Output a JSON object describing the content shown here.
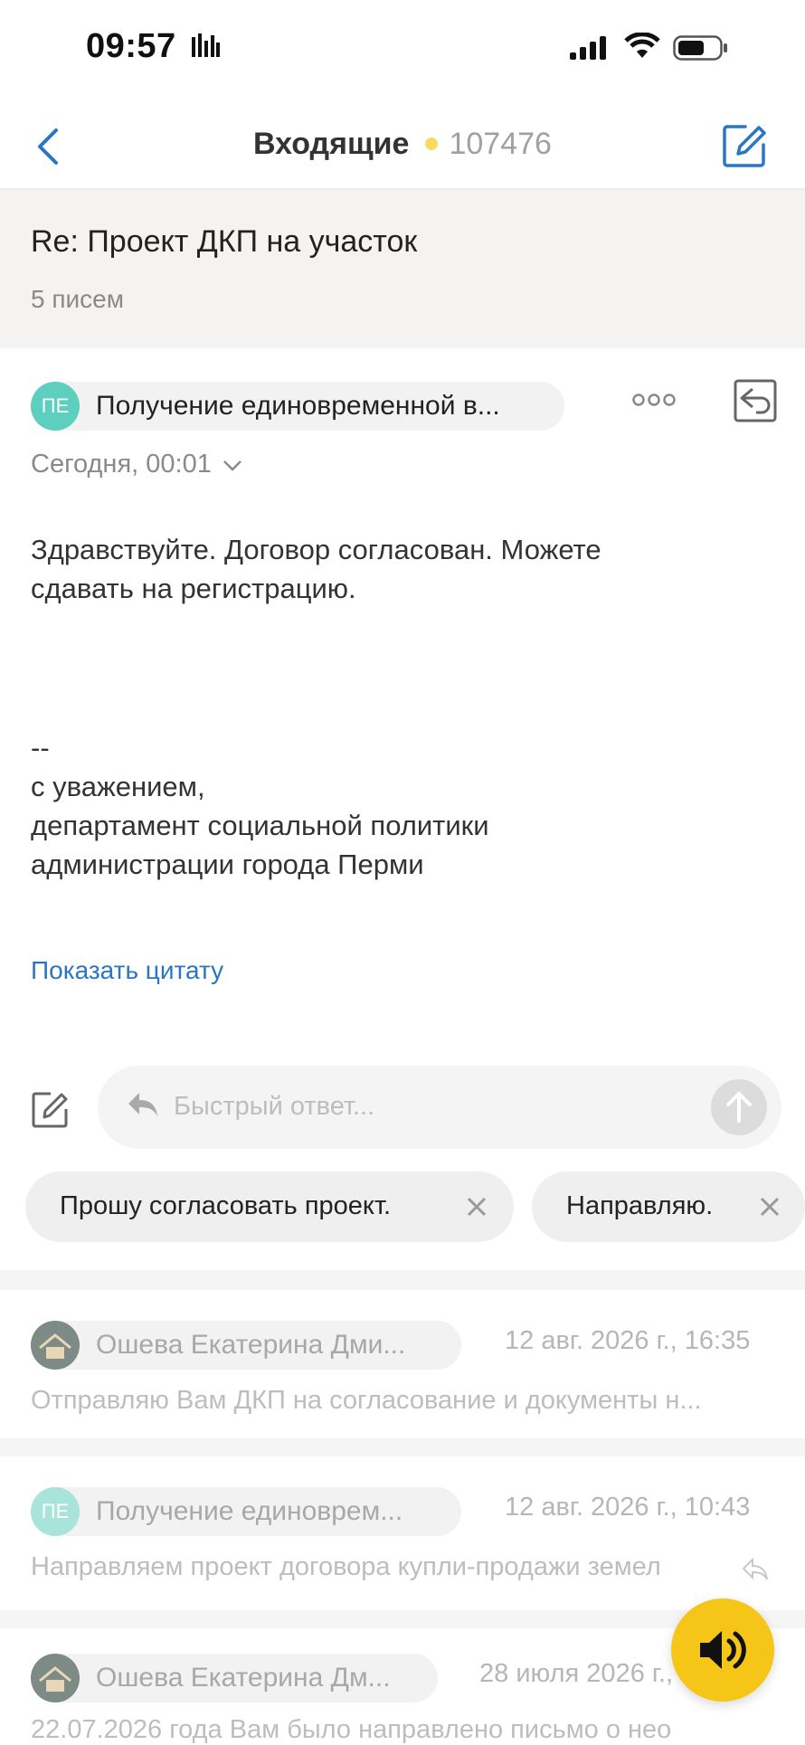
{
  "status": {
    "time": "09:57"
  },
  "nav": {
    "title": "Входящие",
    "count": "107476"
  },
  "thread": {
    "subject": "Re: Проект ДКП на участок",
    "message_count": "5 писем"
  },
  "message": {
    "avatar_initials": "ПЕ",
    "sender": "Получение единовременной в...",
    "date": "Сегодня, 00:01",
    "body_line1": "Здравствуйте. Договор согласован. Можете",
    "body_line2": "сдавать на регистрацию.",
    "sig_dash": "--",
    "sig_line1": "с уважением,",
    "sig_line2": "департамент социальной политики",
    "sig_line3": "администрации города Перми",
    "show_quote": "Показать цитату"
  },
  "quick_reply": {
    "placeholder": "Быстрый ответ...",
    "chips": [
      "Прошу согласовать проект.",
      "Направляю."
    ]
  },
  "older_messages": [
    {
      "sender": "Ошева Екатерина Дми...",
      "date": "12 авг. 2026 г., 16:35",
      "preview": "Отправляю Вам ДКП на согласование и документы н..."
    },
    {
      "avatar_initials": "ПЕ",
      "sender": "Получение единоврем...",
      "date": "12 авг. 2026 г., 10:43",
      "preview": "Направляем проект договора купли-продажи земел"
    },
    {
      "sender": "Ошева Екатерина Дм...",
      "date": "28 июля 2026 г., 5",
      "preview": "22.07.2026 года Вам было направлено письмо о нео"
    }
  ],
  "colors": {
    "accent": "#2b76c4",
    "avatar_teal": "#5ccfbf",
    "fab": "#f5c518",
    "unread_dot": "#f2dd62"
  }
}
